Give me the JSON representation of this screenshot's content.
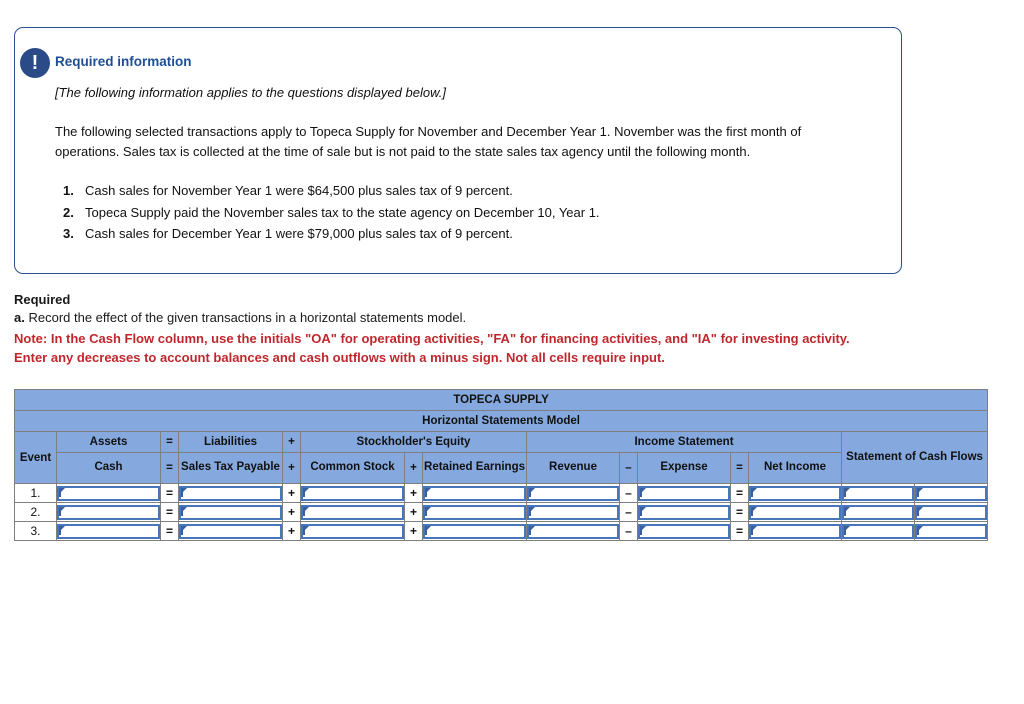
{
  "callout": {
    "icon": "exclamation-circle-icon",
    "title": "Required information",
    "italic_note": "[The following information applies to the questions displayed below.]",
    "paragraph": "The following selected transactions apply to Topeca Supply for November and December Year 1. November was the first month of operations. Sales tax is collected at the time of sale but is not paid to the state sales tax agency until the following month.",
    "transactions": [
      "Cash sales for November Year 1 were $64,500 plus sales tax of 9 percent.",
      "Topeca Supply paid the November sales tax to the state agency on December 10, Year 1.",
      "Cash sales for December Year 1 were $79,000 plus sales tax of 9 percent."
    ]
  },
  "required": {
    "heading": "Required",
    "item_label": "a.",
    "item_text": "Record the effect of the given transactions in a horizontal statements model.",
    "note": "Note: In the Cash Flow column, use the initials \"OA\" for operating activities, \"FA\" for financing activities, and \"IA\" for investing activity. Enter any decreases to account balances and cash outflows with a minus sign. Not all cells require input."
  },
  "table": {
    "company_title": "TOPECA SUPPLY",
    "model_title": "Horizontal Statements Model",
    "event_header": "Event",
    "group_headers": {
      "assets": "Assets",
      "eq1": "=",
      "liabilities": "Liabilities",
      "plus1": "+",
      "equity": "Stockholder's Equity",
      "income_statement": "Income Statement",
      "cash_flows": "Statement of Cash Flows"
    },
    "sub_headers": {
      "cash": "Cash",
      "eq1": "=",
      "sales_tax_payable": "Sales Tax Payable",
      "plus1": "+",
      "common_stock": "Common Stock",
      "plus2": "+",
      "retained_earnings": "Retained Earnings",
      "revenue": "Revenue",
      "minus": "–",
      "expense": "Expense",
      "eq2": "=",
      "net_income": "Net Income"
    },
    "rows": [
      {
        "label": "1.",
        "eq1": "=",
        "plus1": "+",
        "plus2": "+",
        "minus": "–",
        "eq2": "="
      },
      {
        "label": "2.",
        "eq1": "=",
        "plus1": "+",
        "plus2": "+",
        "minus": "–",
        "eq2": "="
      },
      {
        "label": "3.",
        "eq1": "=",
        "plus1": "+",
        "plus2": "+",
        "minus": "–",
        "eq2": "="
      }
    ]
  },
  "colors": {
    "header_blue": "#85a9de",
    "callout_border": "#2d4f8f",
    "badge_blue": "#2a4b87",
    "title_blue": "#1d4e96",
    "note_red": "#c0272d",
    "input_border": "#4876ba",
    "grid_gray": "#7f7f7f"
  }
}
